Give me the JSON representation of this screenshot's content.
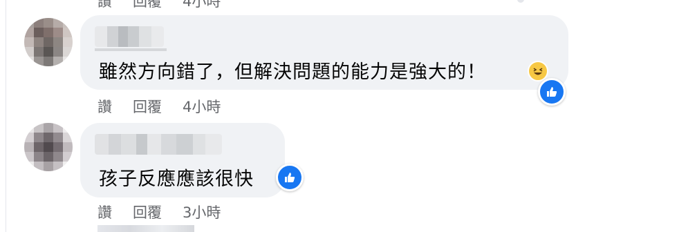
{
  "comments": [
    {
      "text": "雖然方向錯了，但解決問題的能力是強大的！",
      "actions": {
        "like": "讚",
        "reply": "回覆",
        "time": "4小時"
      },
      "reactions": [
        "haha-icon",
        "like-icon"
      ]
    },
    {
      "text": "孩子反應應該很快",
      "actions": {
        "like": "讚",
        "reply": "回覆",
        "time": "3小時"
      },
      "reactions": [
        "like-icon"
      ]
    }
  ],
  "top_partial_actions": {
    "like": "讚",
    "reply": "回覆",
    "time": "4小時"
  },
  "colors": {
    "bubble": "#f0f2f5",
    "text": "#050505",
    "meta": "#65676b",
    "like_blue": "#1877f2"
  }
}
